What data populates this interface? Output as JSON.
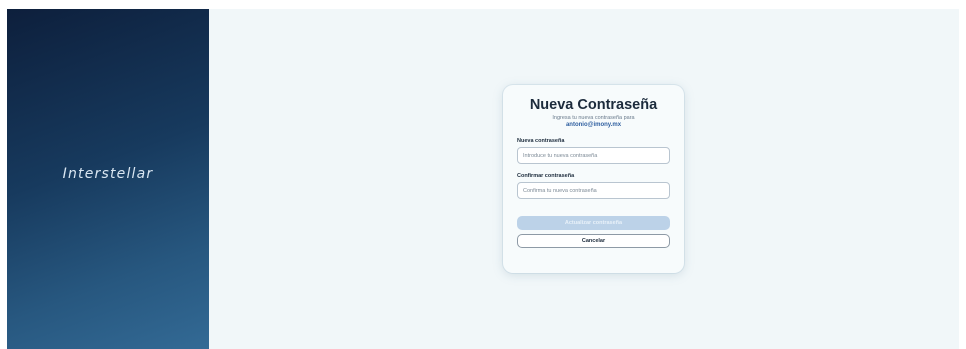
{
  "brand": {
    "logo_text": "Interstellar"
  },
  "card": {
    "title": "Nueva Contraseña",
    "subtitle": "Ingresa tu nueva contraseña para",
    "email": "antonio@imony.mx"
  },
  "form": {
    "new_password_label": "Nueva contraseña",
    "new_password_placeholder": "Introduce tu nueva contraseña",
    "new_password_value": "",
    "confirm_password_label": "Confirmar contraseña",
    "confirm_password_placeholder": "Confirma tu nueva contraseña",
    "confirm_password_value": ""
  },
  "actions": {
    "update_label": "Actualizar contraseña",
    "cancel_label": "Cancelar"
  },
  "colors": {
    "brand_gradient_start": "#0d1f3c",
    "brand_gradient_end": "#336a95",
    "content_background": "#f1f7f9",
    "primary_button_disabled": "#bcd2e8",
    "email_accent": "#2f5fa0"
  }
}
